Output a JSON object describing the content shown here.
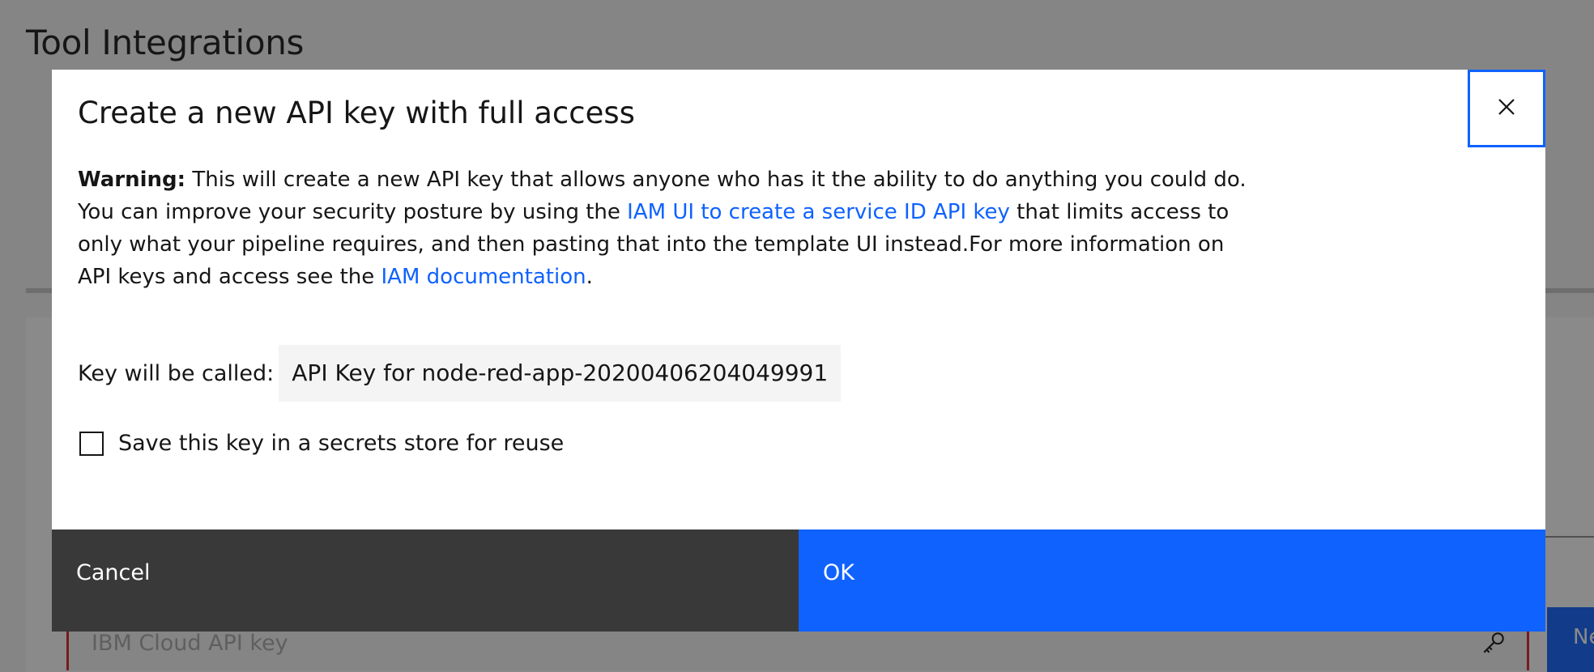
{
  "page": {
    "title": "Tool Integrations",
    "api_key_field": {
      "placeholder": "IBM Cloud API key",
      "icon": "key-icon"
    },
    "next_button_label": "Ne"
  },
  "modal": {
    "title": "Create a new API key with full access",
    "close_icon": "close-icon",
    "warning": {
      "label": "Warning:",
      "text_1": " This will create a new API key that allows anyone who has it the ability to do anything you could do. You can improve your security posture by using the ",
      "link_1": "IAM UI to create a service ID API key",
      "text_2": " that limits access to only what your pipeline requires, and then pasting that into the template UI instead.For more information on API keys and access see the ",
      "link_2": "IAM documentation",
      "text_3": "."
    },
    "key_name": {
      "label": "Key will be called:",
      "value": "API Key for node-red-app-20200406204049991"
    },
    "save_checkbox": {
      "label": "Save this key in a secrets store for reuse",
      "checked": false
    },
    "buttons": {
      "cancel": "Cancel",
      "ok": "OK"
    }
  },
  "colors": {
    "primary": "#0f62fe",
    "secondary_button": "#393939",
    "error_border": "#da1e28",
    "overlay": "rgba(22,22,22,0.5)"
  }
}
